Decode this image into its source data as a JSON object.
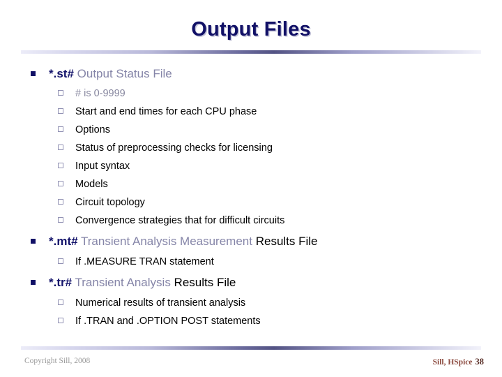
{
  "slide": {
    "title": "Output Files",
    "bullets": [
      {
        "prefix": "*.st#",
        "middle": " Output Status File",
        "suffix": "",
        "sub": [
          {
            "text": "# is 0-9999",
            "muted": true
          },
          {
            "text": "Start and end times for each CPU phase",
            "muted": false
          },
          {
            "text": "Options",
            "muted": false
          },
          {
            "text": "Status of preprocessing checks for licensing",
            "muted": false
          },
          {
            "text": "Input syntax",
            "muted": false
          },
          {
            "text": "Models",
            "muted": false
          },
          {
            "text": "Circuit topology",
            "muted": false
          },
          {
            "text": "Convergence strategies that for difficult circuits",
            "muted": false
          }
        ]
      },
      {
        "prefix": "*.mt#",
        "middle": " Transient Analysis Measurement",
        "suffix": " Results File",
        "sub": [
          {
            "text": "If .MEASURE TRAN statement",
            "muted": false
          }
        ]
      },
      {
        "prefix": "*.tr#",
        "middle": " Transient Analysis",
        "suffix": " Results File",
        "sub": [
          {
            "text": "Numerical results of transient analysis",
            "muted": false
          },
          {
            "text": "If .TRAN and .OPTION POST statements",
            "muted": false
          }
        ]
      }
    ],
    "footer": {
      "copyright": "Copyright Sill, 2008",
      "attribution": "Sill, HSpice",
      "page_number": "38"
    },
    "colors": {
      "title": "#111066",
      "bullet_marker": "#111066",
      "sub_marker_border": "#9292b4",
      "muted_text": "#8585a8",
      "body_text": "#000000",
      "footer_left": "#9a9a9a",
      "footer_right": "#8c4a3f",
      "background": "#ffffff"
    }
  }
}
